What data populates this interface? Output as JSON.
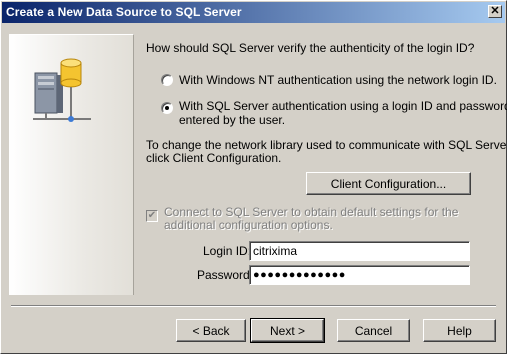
{
  "window": {
    "title": "Create a New Data Source to SQL Server",
    "close_label": "✕"
  },
  "auth": {
    "question": "How should SQL Server verify the authenticity of the login ID?",
    "option_nt": "With Windows NT authentication using the network login ID.",
    "option_sql_line1": "With SQL Server authentication using a login ID and password",
    "option_sql_line2": "entered by the user.",
    "selected": "sql"
  },
  "network": {
    "note_line1": "To change the network library used to communicate with SQL Server,",
    "note_line2": "click Client Configuration.",
    "client_config_label": "Client Configuration..."
  },
  "connect": {
    "checkbox_label_line1": "Connect to SQL Server to obtain default settings for the",
    "checkbox_label_line2": "additional configuration options.",
    "checked": true,
    "enabled": false
  },
  "credentials": {
    "login_label": "Login ID:",
    "login_value": "citrixima",
    "password_label": "Password:",
    "password_value": "●●●●●●●●●●●●●"
  },
  "buttons": {
    "back": "< Back",
    "next": "Next >",
    "cancel": "Cancel",
    "help": "Help"
  }
}
